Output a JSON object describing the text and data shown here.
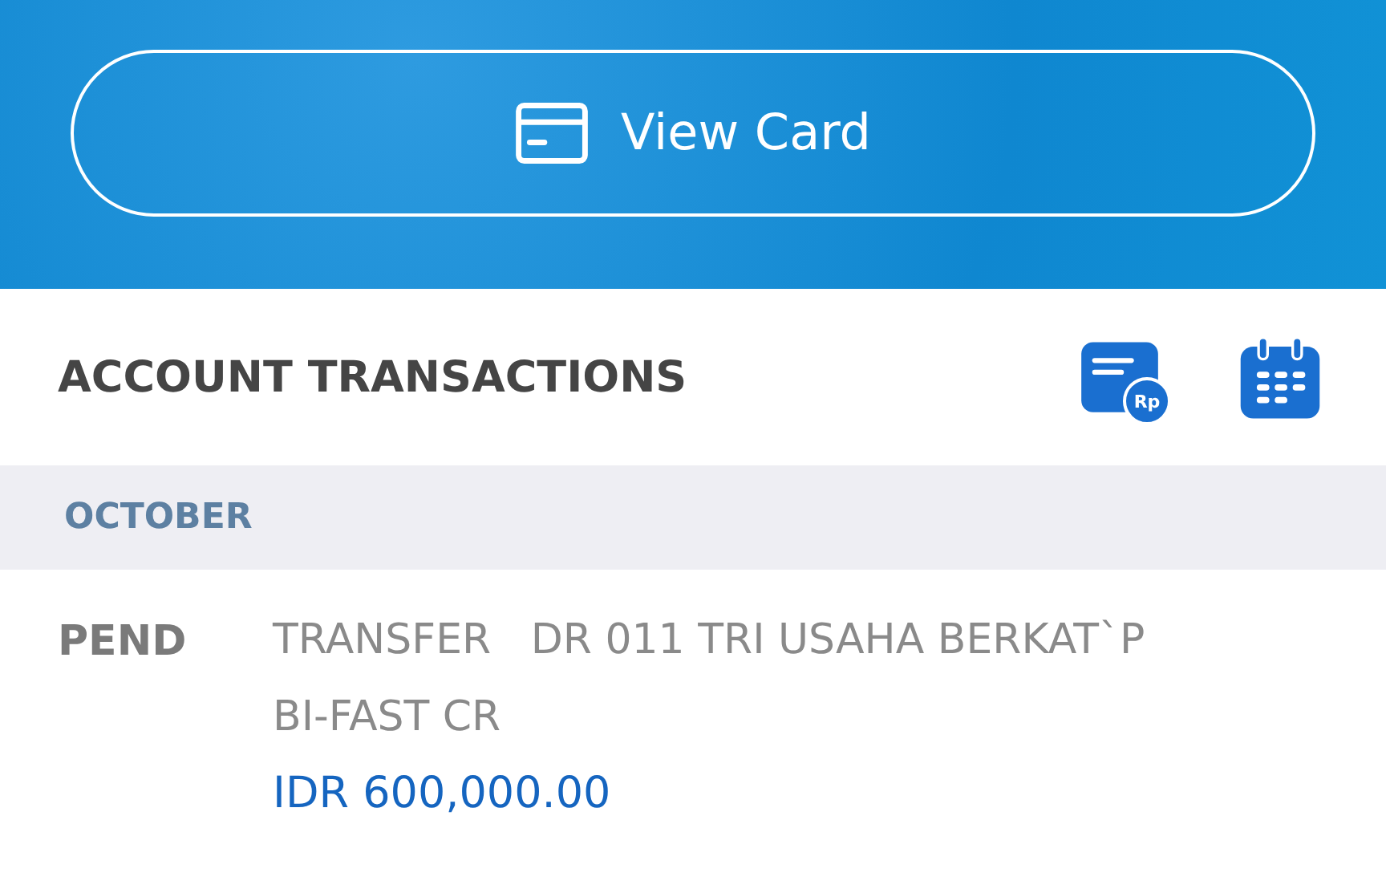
{
  "header": {
    "button": "View Card"
  },
  "section": {
    "title": "ACCOUNT TRANSACTIONS",
    "statement_badge": "Rp"
  },
  "month": "OCTOBER",
  "transactions": [
    {
      "status": "PEND",
      "description_lines": [
        "TRANSFER   DR 011 TRI USAHA BERKAT`P",
        "BI-FAST CR"
      ],
      "amount": "IDR 600,000.00"
    }
  ]
}
